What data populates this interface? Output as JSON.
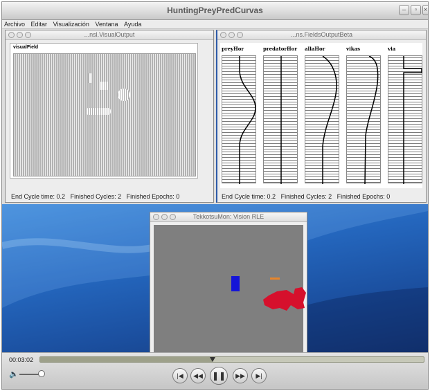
{
  "app": {
    "title": "HuntingPreyPredCurvas",
    "menu": [
      "Archivo",
      "Editar",
      "Visualización",
      "Ventana",
      "Ayuda"
    ]
  },
  "visual_output": {
    "title": "...nsl.VisualOutput",
    "panel_label": "visualField",
    "status": {
      "end_cycle_time_label": "End Cycle time:",
      "end_cycle_time": "0.2",
      "finished_cycles_label": "Finished Cycles:",
      "finished_cycles": "2",
      "finished_epochs_label": "Finished Epochs:",
      "finished_epochs": "0"
    }
  },
  "fields_output": {
    "title": "...ns.FieldsOutputBeta",
    "fields": [
      "preyHor",
      "predatorHor",
      "allaHor",
      "vikas",
      "via"
    ],
    "status": {
      "end_cycle_time_label": "End Cycle time:",
      "end_cycle_time": "0.2",
      "finished_cycles_label": "Finished Cycles:",
      "finished_cycles": "2",
      "finished_epochs_label": "Finished Epochs:",
      "finished_epochs": "0"
    }
  },
  "vision_window": {
    "title": "TekkotsuMon: Vision RLE"
  },
  "player": {
    "time": "00:03:02",
    "progress": 0.45
  },
  "colors": {
    "blue_target": "#1515d8",
    "red_target": "#d6102c",
    "orange_target": "#e8852a"
  }
}
